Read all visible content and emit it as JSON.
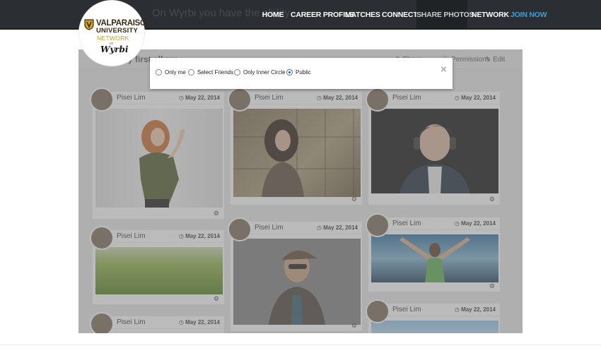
{
  "banner": {
    "text": "On Wyrbi you have the ability"
  },
  "logo": {
    "line1": "VALPARAISO",
    "line2": "UNIVERSITY",
    "line3": "NETWORK",
    "line4": "on",
    "line5": "Wyrbi"
  },
  "nav": {
    "home": "HOME",
    "career_profile": "CAREER PROFILE",
    "matches": "MATCHES",
    "connect": "CONNECT",
    "share_photos": "SHARE PHOTOS",
    "network": "NETWORK",
    "join_now": "JOIN NOW"
  },
  "album": {
    "title": "My first album",
    "share": "Share",
    "permissions": "Permissions",
    "edit": "Edit"
  },
  "privacy_modal": {
    "options": [
      "Only me",
      "Select Friends",
      "Only Inner Circle",
      "Public"
    ],
    "selected": "Public",
    "close_label": "×"
  },
  "posts": [
    {
      "user": "Pisei Lim",
      "date": "May 22, 2014"
    },
    {
      "user": "Pisei Lim",
      "date": "May 22, 2014"
    },
    {
      "user": "Pisei Lim",
      "date": "May 22, 2014"
    },
    {
      "user": "Pisei Lim",
      "date": "May 22, 2014"
    },
    {
      "user": "Pisei Lim",
      "date": "May 22, 2014"
    },
    {
      "user": "Pisei Lim",
      "date": "May 22, 2014"
    },
    {
      "user": "Pisei Lim",
      "date": "May 22, 2014"
    },
    {
      "user": "Pisei Lim",
      "date": "May 22, 2014"
    }
  ],
  "colors": {
    "nav_bg": "#2b2f33",
    "join_now": "#2ea3dc",
    "radio_checked": "#2458a6"
  }
}
